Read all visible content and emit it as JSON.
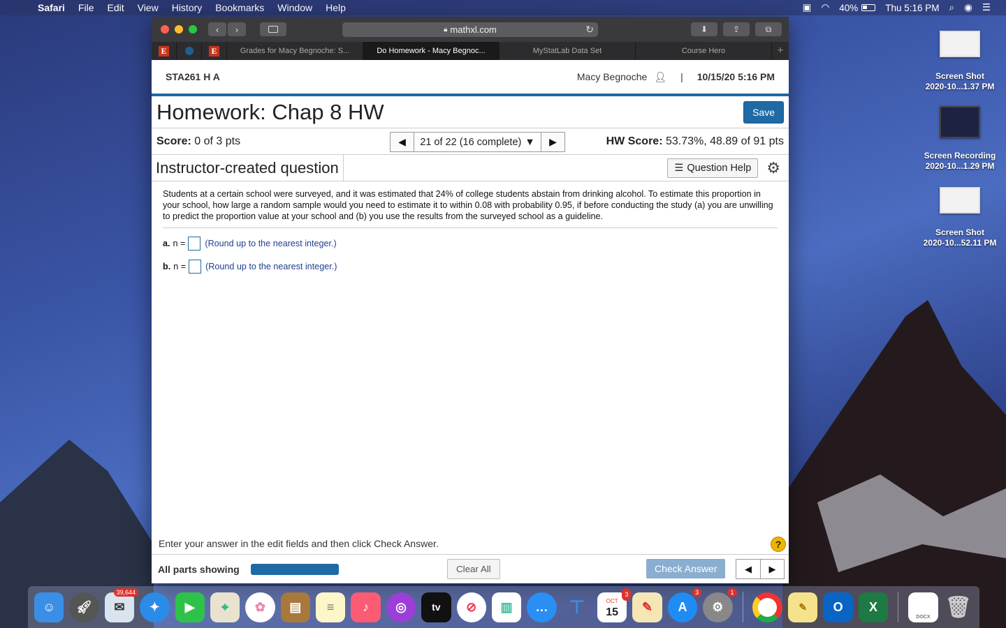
{
  "menubar": {
    "apple": "",
    "app": "Safari",
    "items": [
      "File",
      "Edit",
      "View",
      "History",
      "Bookmarks",
      "Window",
      "Help"
    ],
    "battery": "40%",
    "clock": "Thu 5:16 PM"
  },
  "desktop": [
    {
      "title": "Screen Shot",
      "subtitle": "2020-10...1.37 PM"
    },
    {
      "title": "Screen Recording",
      "subtitle": "2020-10...1.29 PM"
    },
    {
      "title": "Screen Shot",
      "subtitle": "2020-10...52.11 PM"
    }
  ],
  "browser": {
    "url": "mathxl.com",
    "tabs": [
      {
        "label": "Grades for Macy Begnoche: S..."
      },
      {
        "label": "Do Homework - Macy Begnoc..."
      },
      {
        "label": "MyStatLab Data Set"
      },
      {
        "label": "Course Hero"
      }
    ],
    "pinned_labels": [
      "E",
      "E"
    ]
  },
  "page": {
    "course": "STA261 H A",
    "user": "Macy Begnoche",
    "separator": "|",
    "datetime": "10/15/20 5:16 PM",
    "title": "Homework: Chap 8 HW",
    "save_label": "Save",
    "score_label": "Score:",
    "score_value": " 0 of 3 pts",
    "question_selector": "21 of 22 (16 complete)",
    "hw_score_label": "HW Score:",
    "hw_score_value": " 53.73%, 48.89 of 91 pts",
    "question_type": "Instructor-created question",
    "question_help": "Question Help",
    "question_text": "Students at a certain school were surveyed, and it was estimated that 24% of college students abstain from drinking alcohol. To estimate this proportion in your school, how large a random sample would you need to estimate it to within 0.08 with probability 0.95, if before conducting the study (a) you are unwilling to predict the proportion value at your school and (b) you use the results from the surveyed school as a guideline.",
    "answers": [
      {
        "label": "a.",
        "prefix": "n =",
        "value": "",
        "hint": "(Round up to the nearest integer.)"
      },
      {
        "label": "b.",
        "prefix": "n =",
        "value": "",
        "hint": "(Round up to the nearest integer.)"
      }
    ],
    "footer_message": "Enter your answer in the edit fields and then click Check Answer.",
    "help_symbol": "?",
    "parts_label": "All parts showing",
    "parts_progress": 1.0,
    "clear_all": "Clear All",
    "check_answer": "Check Answer"
  },
  "dock": {
    "mail_badge": "39,644",
    "calendar_month": "OCT",
    "calendar_day": "15",
    "calendar_badge": "3",
    "appstore_badge": "3",
    "settings_badge": "1",
    "tv_label": "tv",
    "outlook_label": "O",
    "excel_label": "X",
    "doc_label": "DOCX"
  }
}
